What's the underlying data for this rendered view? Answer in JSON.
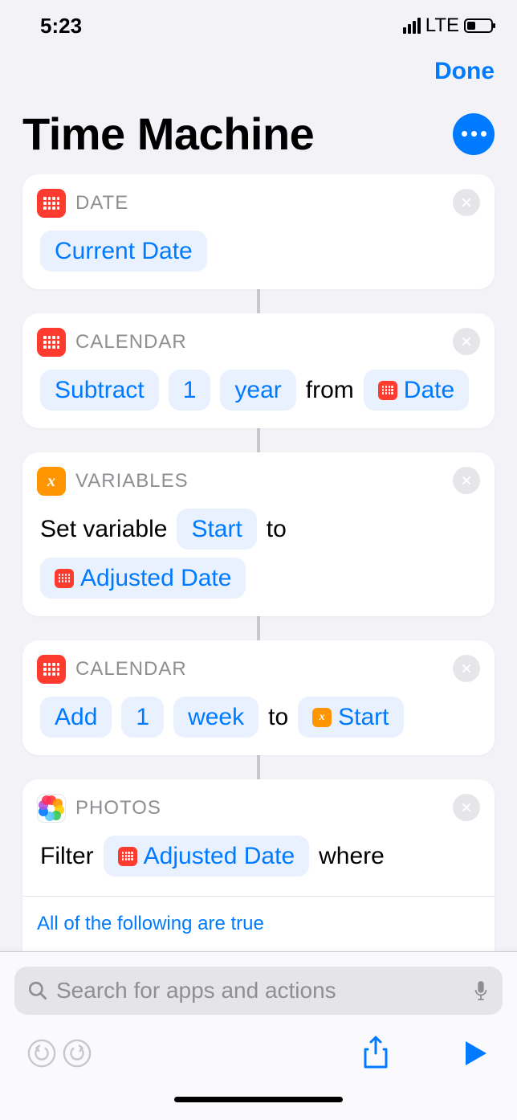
{
  "status": {
    "time": "5:23",
    "network": "LTE"
  },
  "nav": {
    "done": "Done"
  },
  "title": "Time Machine",
  "search": {
    "placeholder": "Search for apps and actions"
  },
  "cards": [
    {
      "category": "DATE",
      "icon": "date",
      "body": {
        "pill0": "Current Date"
      }
    },
    {
      "category": "CALENDAR",
      "icon": "date",
      "body": {
        "pill0": "Subtract",
        "pill1": "1",
        "pill2": "year",
        "text0": "from",
        "var0": "Date"
      }
    },
    {
      "category": "VARIABLES",
      "icon": "variable",
      "body": {
        "text0": "Set variable",
        "pill0": "Start",
        "text1": "to",
        "var0": "Adjusted Date"
      }
    },
    {
      "category": "CALENDAR",
      "icon": "date",
      "body": {
        "pill0": "Add",
        "pill1": "1",
        "pill2": "week",
        "text0": "to",
        "var0": "Start"
      }
    },
    {
      "category": "PHOTOS",
      "icon": "photos",
      "body": {
        "text0": "Filter",
        "var0": "Adjusted Date",
        "text1": "where"
      },
      "subtext": "All of the following are true"
    }
  ]
}
